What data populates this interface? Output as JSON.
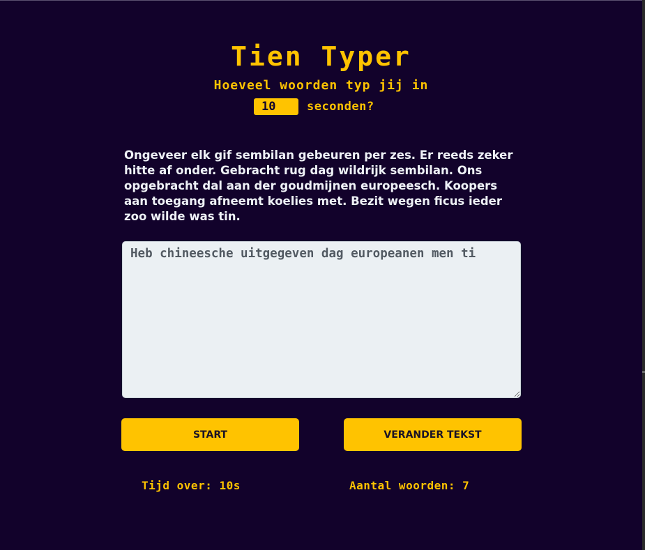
{
  "header": {
    "title": "Tien Typer",
    "subtitle": "Hoeveel woorden typ jij in",
    "seconds_value": "10",
    "seconds_label": "seconden?"
  },
  "main": {
    "source_text": "Ongeveer elk gif sembilan gebeuren per zes. Er reeds zeker hitte af onder. Gebracht rug dag wildrijk sembilan. Ons opgebracht dal aan der goudmijnen europeesch. Koopers aan toegang afneemt koelies met. Bezit wegen ficus ieder zoo wilde was tin.",
    "typed_text": "Heb chineesche uitgegeven dag europeanen men ti"
  },
  "controls": {
    "start_label": "START",
    "change_text_label": "VERANDER TEKST"
  },
  "stats": {
    "time_left": "Tijd over: 10s",
    "word_count": "Aantal woorden: 7"
  },
  "colors": {
    "background": "#12022b",
    "accent": "#ffc300",
    "text": "#eef1f6",
    "textarea_bg": "#ebf0f3"
  }
}
